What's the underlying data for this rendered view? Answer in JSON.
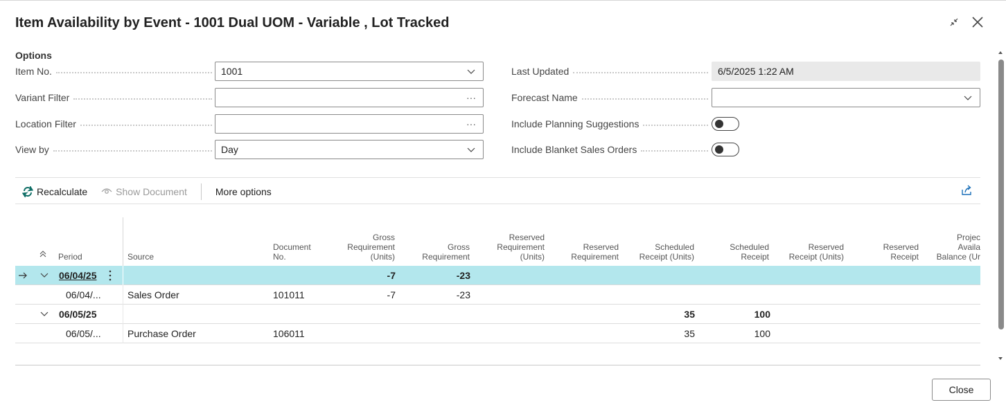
{
  "window": {
    "title": "Item Availability by Event - 1001 Dual UOM - Variable , Lot Tracked"
  },
  "options": {
    "heading": "Options",
    "item_no": {
      "label": "Item No.",
      "value": "1001"
    },
    "variant_filter": {
      "label": "Variant Filter",
      "value": ""
    },
    "location_filter": {
      "label": "Location Filter",
      "value": ""
    },
    "view_by": {
      "label": "View by",
      "value": "Day"
    },
    "last_updated": {
      "label": "Last Updated",
      "value": "6/5/2025 1:22 AM"
    },
    "forecast_name": {
      "label": "Forecast Name",
      "value": ""
    },
    "include_planning_suggestions": {
      "label": "Include Planning Suggestions",
      "on": false
    },
    "include_blanket_sales_orders": {
      "label": "Include Blanket Sales Orders",
      "on": false
    },
    "ellipsis": "···"
  },
  "toolbar": {
    "recalculate": "Recalculate",
    "show_document": "Show Document",
    "more_options": "More options"
  },
  "grid": {
    "headers": {
      "period": "Period",
      "source": "Source",
      "document_no_1": "Document",
      "document_no_2": "No.",
      "gross_req_units_1": "Gross",
      "gross_req_units_2": "Requirement",
      "gross_req_units_3": "(Units)",
      "gross_req_1": "Gross",
      "gross_req_2": "Requirement",
      "reserved_req_units_1": "Reserved",
      "reserved_req_units_2": "Requirement",
      "reserved_req_units_3": "(Units)",
      "reserved_req_1": "Reserved",
      "reserved_req_2": "Requirement",
      "scheduled_receipt_units_1": "Scheduled",
      "scheduled_receipt_units_2": "Receipt (Units)",
      "scheduled_receipt_1": "Scheduled",
      "scheduled_receipt_2": "Receipt",
      "reserved_receipt_units_1": "Reserved",
      "reserved_receipt_units_2": "Receipt (Units)",
      "reserved_receipt_1": "Reserved",
      "reserved_receipt_2": "Receipt",
      "projected_1": "Projec",
      "projected_2": "Availa",
      "projected_3": "Balance (Ur"
    },
    "rows": [
      {
        "period": "06/04/25",
        "source": "",
        "document_no": "",
        "gross_req_units": "-7",
        "gross_req": "-23",
        "scheduled_receipt_units": "",
        "scheduled_receipt": ""
      },
      {
        "period": "06/04/...",
        "source": "Sales Order",
        "document_no": "101011",
        "gross_req_units": "-7",
        "gross_req": "-23",
        "scheduled_receipt_units": "",
        "scheduled_receipt": ""
      },
      {
        "period": "06/05/25",
        "source": "",
        "document_no": "",
        "gross_req_units": "",
        "gross_req": "",
        "scheduled_receipt_units": "35",
        "scheduled_receipt": "100"
      },
      {
        "period": "06/05/...",
        "source": "Purchase Order",
        "document_no": "106011",
        "gross_req_units": "",
        "gross_req": "",
        "scheduled_receipt_units": "35",
        "scheduled_receipt": "100"
      }
    ]
  },
  "footer": {
    "close": "Close"
  }
}
